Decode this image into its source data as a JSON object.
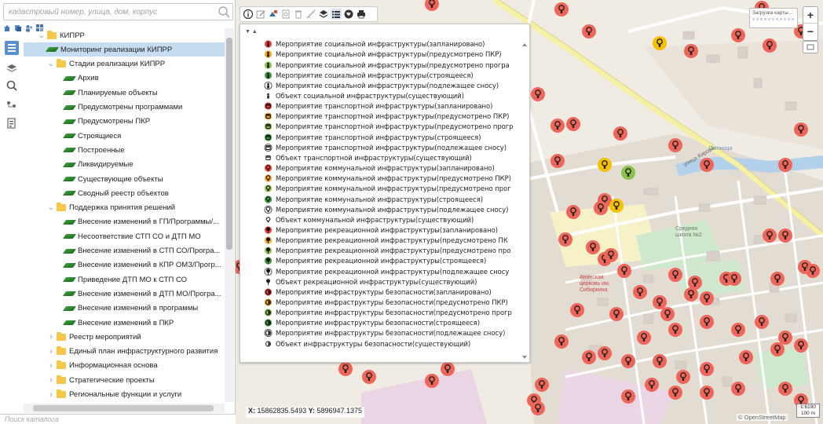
{
  "search": {
    "placeholder": "кадастровый номер, улица, дом, корпус"
  },
  "catalog_search": {
    "placeholder": "Поиск каталога"
  },
  "tree": [
    {
      "label": "КИПРР",
      "type": "folder",
      "level": 0,
      "expanded": true
    },
    {
      "label": "Мониторинг реализации КИПРР",
      "type": "leaf",
      "level": 1,
      "selected": true
    },
    {
      "label": "Стадии реализации КИПРР",
      "type": "folder",
      "level": 1,
      "expanded": true
    },
    {
      "label": "Архив",
      "type": "leaf",
      "level": 2
    },
    {
      "label": "Планируемые объекты",
      "type": "leaf",
      "level": 2
    },
    {
      "label": "Предусмотрены программами",
      "type": "leaf",
      "level": 2
    },
    {
      "label": "Предусмотрены ПКР",
      "type": "leaf",
      "level": 2
    },
    {
      "label": "Строящиеся",
      "type": "leaf",
      "level": 2
    },
    {
      "label": "Построенные",
      "type": "leaf",
      "level": 2
    },
    {
      "label": "Ликвидируемые",
      "type": "leaf",
      "level": 2
    },
    {
      "label": "Существующие объекты",
      "type": "leaf",
      "level": 2
    },
    {
      "label": "Сводный реестр объектов",
      "type": "leaf",
      "level": 2
    },
    {
      "label": "Поддержка принятия решений",
      "type": "folder",
      "level": 1,
      "expanded": true
    },
    {
      "label": "Внесение изменений в ГП/Программы/...",
      "type": "leaf",
      "level": 2
    },
    {
      "label": "Несоответствие СТП СО и ДТП МО",
      "type": "leaf",
      "level": 2
    },
    {
      "label": "Внесение изменений в СТП СО/Програ...",
      "type": "leaf",
      "level": 2
    },
    {
      "label": "Внесение изменений в КПР ОМЗ/Прогр...",
      "type": "leaf",
      "level": 2
    },
    {
      "label": "Приведение ДТП МО к СТП СО",
      "type": "leaf",
      "level": 2
    },
    {
      "label": "Внесение изменений в ДТП МО/Програ...",
      "type": "leaf",
      "level": 2
    },
    {
      "label": "Внесение изменений в программы",
      "type": "leaf",
      "level": 2
    },
    {
      "label": "Внесение изменений в ПКР",
      "type": "leaf",
      "level": 2
    },
    {
      "label": "Реестр мероприятий",
      "type": "folder",
      "level": 1,
      "expanded": false
    },
    {
      "label": "Единый план инфраструктурного развития",
      "type": "folder",
      "level": 1,
      "expanded": false
    },
    {
      "label": "Информационная основа",
      "type": "folder",
      "level": 1,
      "expanded": false
    },
    {
      "label": "Стратегические проекты",
      "type": "folder",
      "level": 1,
      "expanded": false
    },
    {
      "label": "Региональные функции и услуги",
      "type": "folder",
      "level": 1,
      "expanded": false
    }
  ],
  "legend": {
    "collapse_glyph": "▼ ▲",
    "items": [
      {
        "label": "Мероприятие социальной инфраструктуры(запланировано)",
        "icon": "person-pin-icon",
        "color": "#e8423a"
      },
      {
        "label": "Мероприятие социальной инфраструктуры(предусмотрено ПКР)",
        "icon": "person-pin-icon",
        "color": "#f5a623"
      },
      {
        "label": "Мероприятие социальной инфраструктуры(предусмотрено програ",
        "icon": "person-pin-icon",
        "color": "#8bc34a"
      },
      {
        "label": "Мероприятие социальной инфраструктуры(строящееся)",
        "icon": "person-pin-icon",
        "color": "#3c9a3c"
      },
      {
        "label": "Мероприятие социальной инфраструктуры(подлежащее сносу)",
        "icon": "person-pin-icon",
        "color": "#ffffff"
      },
      {
        "label": "Объект социальной инфраструктуры(существующий)",
        "icon": "person-icon",
        "color": "#222222"
      },
      {
        "label": "Мероприятие транспортной инфраструктуры(запланировано)",
        "icon": "bus-pin-icon",
        "color": "#e8423a"
      },
      {
        "label": "Мероприятие транспортной инфраструктуры(предусмотрено ПКР)",
        "icon": "bus-pin-icon",
        "color": "#f5a623"
      },
      {
        "label": "Мероприятие транспортной инфраструктуры(предусмотрено прогр",
        "icon": "bus-pin-icon",
        "color": "#8bc34a"
      },
      {
        "label": "Мероприятие транспортной инфраструктуры(строящееся)",
        "icon": "bus-pin-icon",
        "color": "#3c9a3c"
      },
      {
        "label": "Мероприятие транспортной инфраструктуры(подлежащее сносу)",
        "icon": "bus-pin-icon",
        "color": "#ffffff"
      },
      {
        "label": "Объект транспортной инфраструктуры(существующий)",
        "icon": "bus-icon",
        "color": "#222222"
      },
      {
        "label": "Мероприятие коммунальной инфраструктуры(запланировано)",
        "icon": "bulb-pin-icon",
        "color": "#e8423a"
      },
      {
        "label": "Мероприятие коммунальной инфраструктуры(предусмотрено ПКР)",
        "icon": "bulb-pin-icon",
        "color": "#f5a623"
      },
      {
        "label": "Мероприятие коммунальной инфраструктуры(предусмотрено прог",
        "icon": "bulb-pin-icon",
        "color": "#8bc34a"
      },
      {
        "label": "Мероприятие коммунальной инфраструктуры(строящееся)",
        "icon": "bulb-pin-icon",
        "color": "#3c9a3c"
      },
      {
        "label": "Мероприятие коммунальной инфраструктуры(подлежащее сносу)",
        "icon": "bulb-pin-icon",
        "color": "#ffffff"
      },
      {
        "label": "Объект коммунальной инфраструктуры(существующий)",
        "icon": "bulb-icon",
        "color": "#222222"
      },
      {
        "label": "Мероприятие рекреационной инфраструктуры(запланировано)",
        "icon": "tree-pin-icon",
        "color": "#e8423a"
      },
      {
        "label": "Мероприятие рекреационной инфраструктуры(предусмотрено ПК",
        "icon": "tree-pin-icon",
        "color": "#f5a623"
      },
      {
        "label": "Мероприятие рекреационной инфраструктуры(предусмотрено про",
        "icon": "tree-pin-icon",
        "color": "#8bc34a"
      },
      {
        "label": "Мероприятие рекреационной инфраструктуры(строящееся)",
        "icon": "tree-pin-icon",
        "color": "#3c9a3c"
      },
      {
        "label": "Мероприятие рекреационной инфраструктуры(подлежащее сносу",
        "icon": "tree-pin-icon",
        "color": "#ffffff"
      },
      {
        "label": "Объект рекреационной инфраструктуры(существующий)",
        "icon": "tree-icon",
        "color": "#222222"
      },
      {
        "label": "Мероприятие инфраструктуры безопасности(запланировано)",
        "icon": "shield-pin-icon",
        "color": "#e8423a"
      },
      {
        "label": "Мероприятие инфраструктуры безопасности(предусмотрено ПКР)",
        "icon": "shield-pin-icon",
        "color": "#f5a623"
      },
      {
        "label": "Мероприятие инфраструктуры безопасности(предусмотрено прогр",
        "icon": "shield-pin-icon",
        "color": "#8bc34a"
      },
      {
        "label": "Мероприятие инфраструктуры безопасности(строящееся)",
        "icon": "shield-pin-icon",
        "color": "#3c9a3c"
      },
      {
        "label": "Мероприятие инфраструктуры безопасности(подлежащее сносу)",
        "icon": "shield-pin-icon",
        "color": "#ffffff"
      },
      {
        "label": "Объект инфраструктуры безопасности(существующий)",
        "icon": "shield-icon",
        "color": "#222222"
      }
    ]
  },
  "coords": {
    "x_label": "X:",
    "x": "15862835.5493",
    "y_label": "Y:",
    "y": "5896947.1375"
  },
  "zoom": {
    "in": "+",
    "out": "−"
  },
  "loading": {
    "text": "Загрузка карты..."
  },
  "scale": {
    "ratio": "1:6190",
    "distance": "100 m"
  },
  "attribution": "© OpenStreetMap",
  "map_labels": {
    "school": "Средняя школа №2",
    "church": "Анинская церковь им. Сибиркина",
    "river": "Пятница",
    "street": "улица Кирова"
  },
  "colors": {
    "marker_red": "#f0655a",
    "marker_yellow": "#f5c000",
    "marker_green": "#8bc34a",
    "selection": "#c6dcf1",
    "road_yellow": "#f6f0a4"
  }
}
